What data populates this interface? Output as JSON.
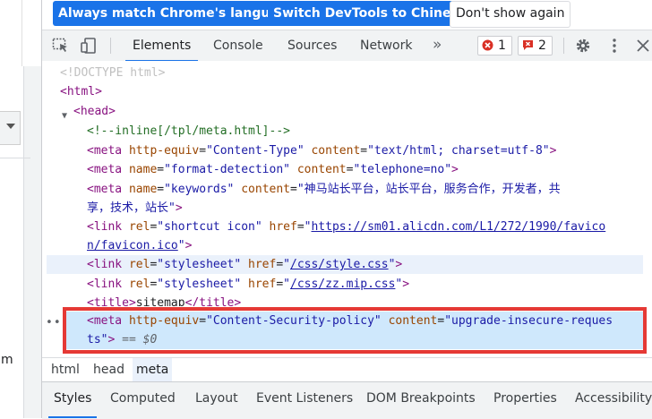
{
  "page": {
    "partial_text": "m"
  },
  "infobar": {
    "match_language": "Always match Chrome's language",
    "switch_chinese": "Switch DevTools to Chinese",
    "dont_show": "Don't show again"
  },
  "tabs": {
    "elements": "Elements",
    "console": "Console",
    "sources": "Sources",
    "network": "Network",
    "more": "»"
  },
  "status": {
    "errors": "1",
    "issues": "2"
  },
  "dom": {
    "doctype": "<!DOCTYPE html>",
    "l_html": "<html>",
    "l_head": "<head>",
    "comment": "<!--inline[/tpl/meta.html]-->",
    "m1_tag": "<meta",
    "m1_attr1": "http-equiv",
    "m1_val1": "\"Content-Type\"",
    "m1_attr2": "content",
    "m1_val2": "\"text/html; charset=utf-8\"",
    "m2_attr1": "name",
    "m2_val1": "\"format-detection\"",
    "m2_attr2": "content",
    "m2_val2": "\"telephone=no\"",
    "m3_attr1": "name",
    "m3_val1": "\"keywords\"",
    "m3_attr2": "content",
    "m3_val2a": "\"神马站长平台，站长平台，服务合作，开发者，共",
    "m3_val2b": "享，技术，站长\"",
    "link_tag": "<link",
    "rel": "rel",
    "href": "href",
    "l1_rel": "\"shortcut icon\"",
    "l1_href_a": "https://sm01.alicdn.com/L1/272/1990/favico",
    "l1_href_b": "n/favicon.ico",
    "l2_rel": "\"stylesheet\"",
    "l2_href": "/css/style.css",
    "l3_rel": "\"stylesheet\"",
    "l3_href": "/css/zz.mip.css",
    "title_open": "<title>",
    "title_text": "sitemap",
    "title_close": "</title>",
    "sel_attr1": "http-equiv",
    "sel_val1": "\"Content-Security-policy\"",
    "sel_attr2": "content",
    "sel_val2a": "\"upgrade-insecure-reques",
    "sel_val2b": "ts\"",
    "sel_marker": "== $0",
    "close": ">",
    "quote": "\""
  },
  "breadcrumbs": [
    "html",
    "head",
    "meta"
  ],
  "subtabs": [
    "Styles",
    "Computed",
    "Layout",
    "Event Listeners",
    "DOM Breakpoints",
    "Properties",
    "Accessibility"
  ],
  "colors": {
    "accent": "#1a73e8",
    "highlight": "#e53935",
    "error": "#d93025"
  }
}
